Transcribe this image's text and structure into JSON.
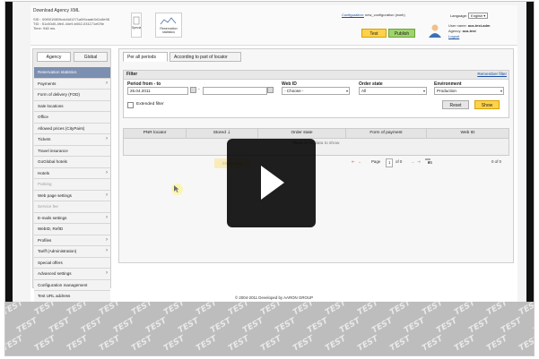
{
  "header": {
    "app_title": "Download Agency XML",
    "meta_lines": [
      "SID : 00f0019809cdd4d1271a0f4caab3d1c8e98",
      "TID : 51c50d0-4fe0-44e9-b062-031171ef29e",
      "Time: 948 ms."
    ],
    "tiles": [
      {
        "label": "Special offers"
      },
      {
        "label": "Reservation statistics"
      }
    ],
    "configuration_label": "Configuration:",
    "configuration_value": "new_configuration (work)",
    "env_test": "Test",
    "env_publish": "Publish",
    "language_label": "Language:",
    "language_value": "English",
    "user_name_label": "User name:",
    "user_name_value": "aca-test-adm",
    "agency_label": "Agency:",
    "agency_value": "aca-test",
    "logout": "Logout"
  },
  "sidebar": {
    "tabs": [
      "Agency",
      "Global"
    ],
    "items": [
      {
        "label": "Reservation statistics",
        "active": true
      },
      {
        "label": "Payments",
        "arrow": true
      },
      {
        "label": "Form of delivery (FOD)"
      },
      {
        "label": "Sale locations"
      },
      {
        "label": "Office"
      },
      {
        "label": "Allowed prices (CityPairs)"
      },
      {
        "label": "Tickets",
        "arrow": true
      },
      {
        "label": "Travel insurance"
      },
      {
        "label": "GoGlobal hotels"
      },
      {
        "label": "Hotels",
        "arrow": true
      },
      {
        "label": "Parking",
        "disabled": true
      },
      {
        "label": "Web page settings",
        "arrow": true
      },
      {
        "label": "Service fee",
        "disabled": true
      },
      {
        "label": "E-mails settings",
        "arrow": true
      },
      {
        "label": "WebID, RefID"
      },
      {
        "label": "Profiles",
        "arrow": true
      },
      {
        "label": "Tariff (Administration)",
        "arrow": true
      },
      {
        "label": "Special offers"
      },
      {
        "label": "Advanced settings",
        "arrow": true
      },
      {
        "label": "Configuration management"
      },
      {
        "label": "Test URL address"
      }
    ]
  },
  "main": {
    "tabs": [
      "Per all periods",
      "According to part of locator"
    ],
    "filter": {
      "title": "Filter",
      "remember": "Remember filter",
      "period_label": "Period from - to",
      "date_from": "25.04.2011",
      "date_sep": "-",
      "date_to": "",
      "webid_label": "Web ID",
      "webid_value": "- Choose -",
      "order_state_label": "Order state",
      "order_state_value": "All",
      "environment_label": "Environment",
      "environment_value": "Production",
      "extended_filter": "Extended filter",
      "reset": "Reset",
      "show": "Show"
    },
    "grid": {
      "columns": [
        "PNR locator",
        "Stored",
        "Order state",
        "Form of payment",
        "Web ID"
      ],
      "sort_marker": "⇣",
      "empty_text": "There is no data to show."
    },
    "pager": {
      "page_label": "Page",
      "page_value": "1",
      "of_label": "of 0",
      "page_size": "25",
      "range": "0 of 0"
    },
    "show_more": "Show more"
  },
  "footer": "© 2004-2011 Developed by AARON GROUP",
  "watermark": "TEST",
  "colors": {
    "active_menu": "#7b8fb1",
    "show_button": "#ffd24a",
    "publish_button": "#9fd46a",
    "link": "#1a4fa0"
  },
  "overlay": {
    "icon": "play-icon"
  }
}
